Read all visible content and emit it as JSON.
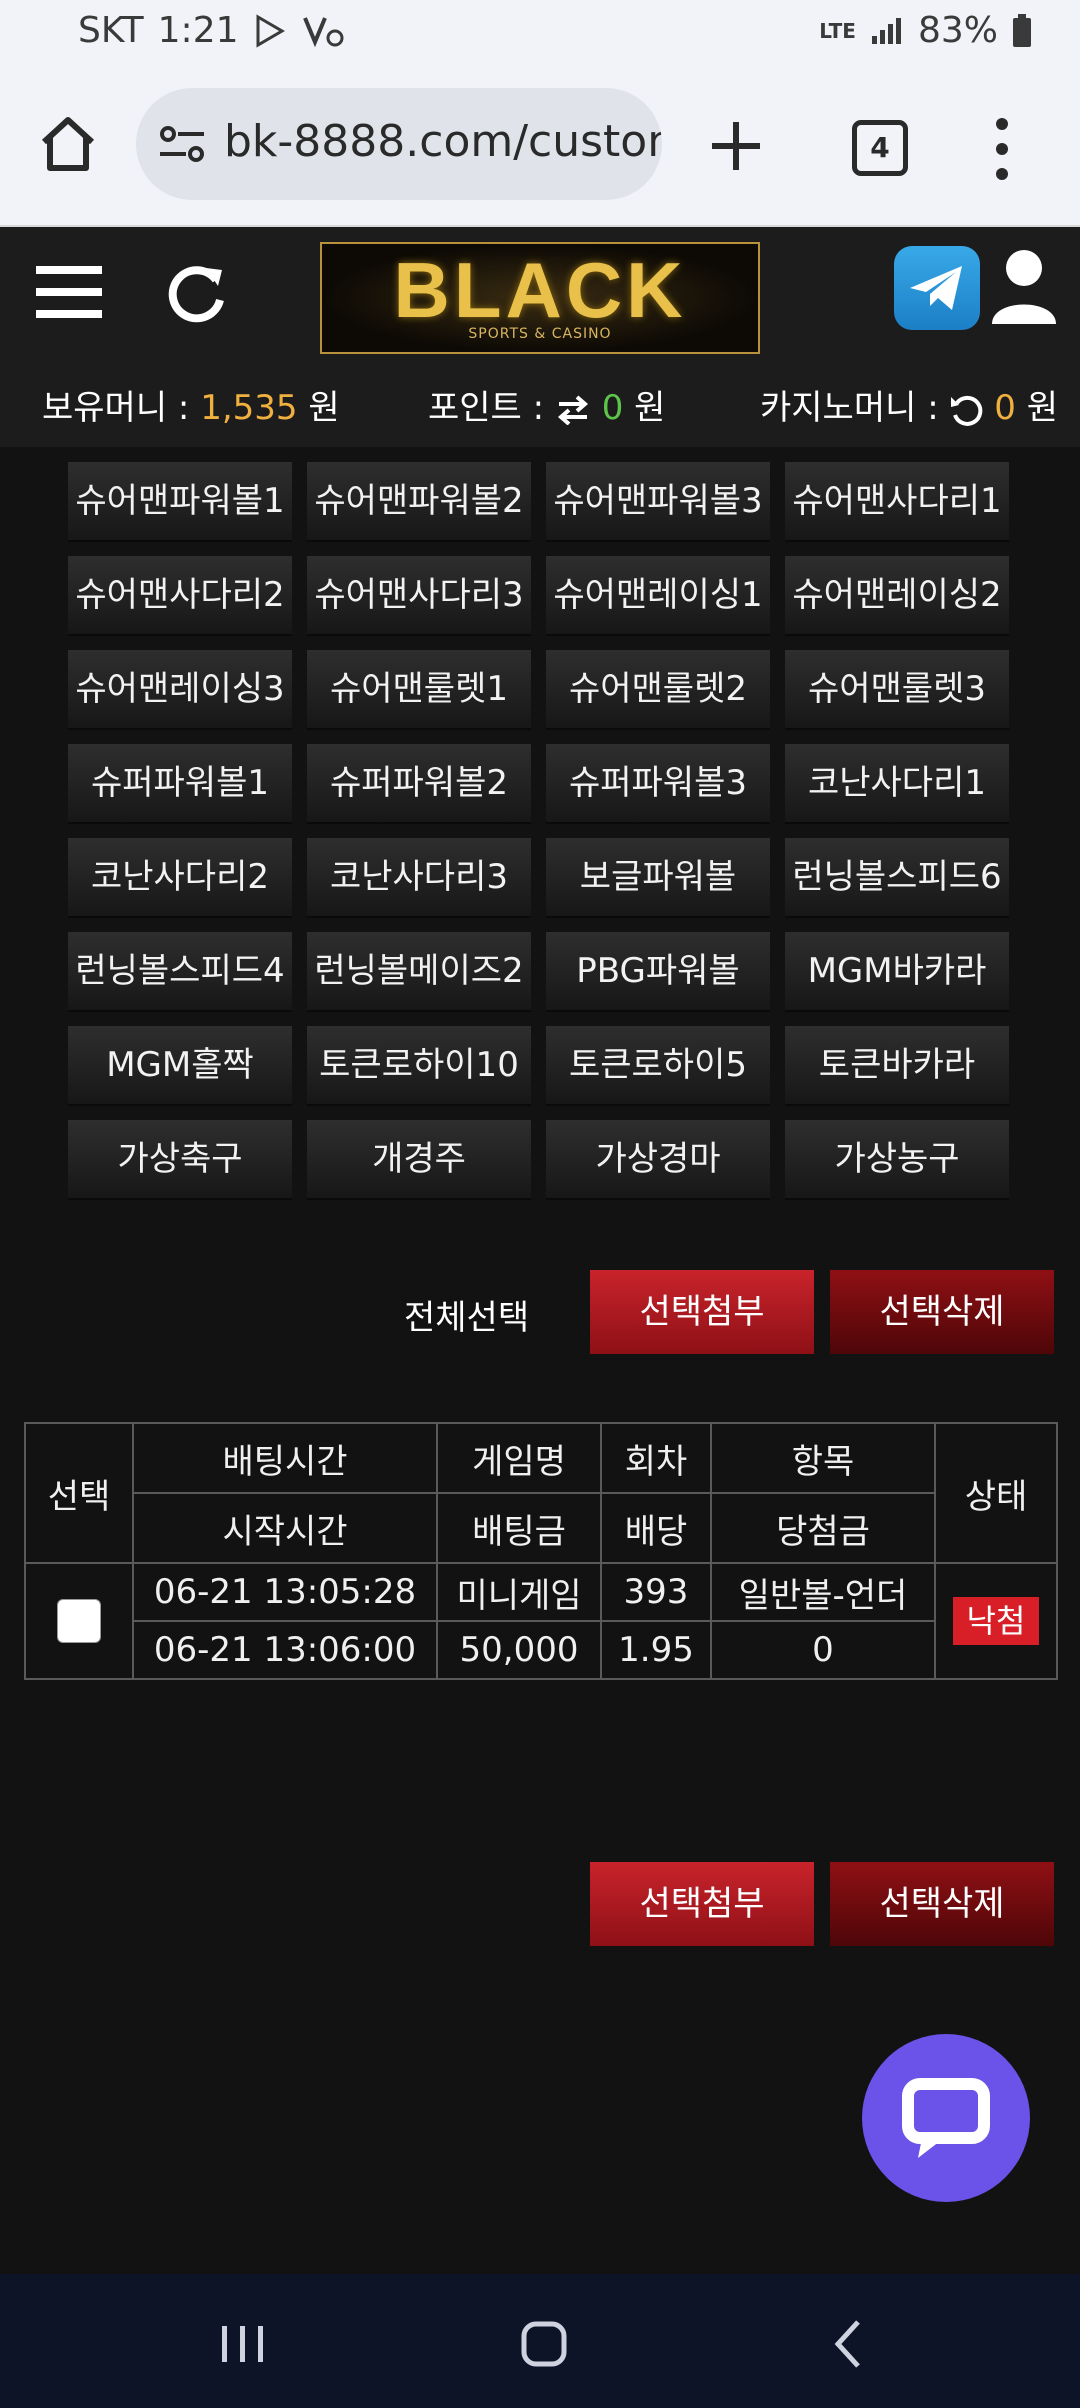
{
  "status_bar": {
    "carrier": "SKT",
    "time": "1:21",
    "network": "LTE",
    "battery": "83%"
  },
  "browser": {
    "url": "bk-8888.com/custon",
    "tab_count": "4"
  },
  "header": {
    "logo_text": "BLACK",
    "logo_subtext": "SPORTS & CASINO"
  },
  "balance": {
    "money_label": "보유머니 : ",
    "money_value": "1,535",
    "money_unit": " 원",
    "point_label": "포인트 : ",
    "point_value": "0",
    "point_unit": " 원",
    "casino_label": "카지노머니 : ",
    "casino_value": "0",
    "casino_unit": " 원"
  },
  "games": [
    "슈어맨파워볼1",
    "슈어맨파워볼2",
    "슈어맨파워볼3",
    "슈어맨사다리1",
    "슈어맨사다리2",
    "슈어맨사다리3",
    "슈어맨레이싱1",
    "슈어맨레이싱2",
    "슈어맨레이싱3",
    "슈어맨룰렛1",
    "슈어맨룰렛2",
    "슈어맨룰렛3",
    "슈퍼파워볼1",
    "슈퍼파워볼2",
    "슈퍼파워볼3",
    "코난사다리1",
    "코난사다리2",
    "코난사다리3",
    "보글파워볼",
    "런닝볼스피드6",
    "런닝볼스피드4",
    "런닝볼메이즈2",
    "PBG파워볼",
    "MGM바카라",
    "MGM홀짝",
    "토큰로하이10",
    "토큰로하이5",
    "토큰바카라",
    "가상축구",
    "개경주",
    "가상경마",
    "가상농구"
  ],
  "actions": {
    "select_all": "전체선택",
    "attach_selected": "선택첨부",
    "delete_selected": "선택삭제"
  },
  "table": {
    "headers": {
      "select": "선택",
      "bet_time": "배팅시간",
      "game_name": "게임명",
      "round": "회차",
      "item": "항목",
      "status": "상태",
      "start_time": "시작시간",
      "bet_amount": "배팅금",
      "odds": "배당",
      "win_amount": "당첨금"
    },
    "row": {
      "bet_time": "06-21 13:05:28",
      "game_name": "미니게임",
      "round": "393",
      "item": "일반볼-언더",
      "status": "낙첨",
      "start_time": "06-21 13:06:00",
      "bet_amount": "50,000",
      "odds": "1.95",
      "win_amount": "0"
    }
  }
}
